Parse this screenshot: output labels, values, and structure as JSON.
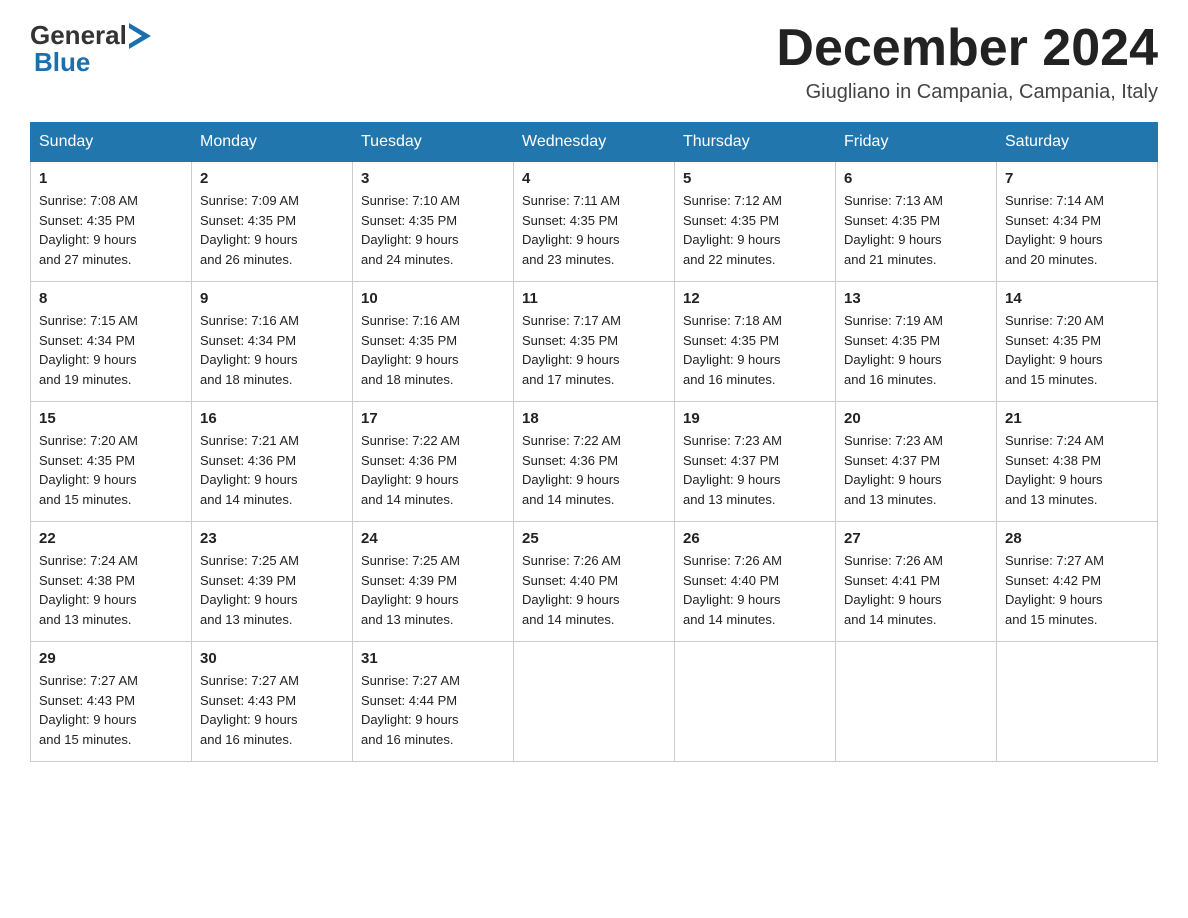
{
  "header": {
    "logo": {
      "general": "General",
      "blue": "Blue"
    },
    "title": "December 2024",
    "location": "Giugliano in Campania, Campania, Italy"
  },
  "days_of_week": [
    "Sunday",
    "Monday",
    "Tuesday",
    "Wednesday",
    "Thursday",
    "Friday",
    "Saturday"
  ],
  "weeks": [
    [
      {
        "day": "1",
        "sunrise": "Sunrise: 7:08 AM",
        "sunset": "Sunset: 4:35 PM",
        "daylight": "Daylight: 9 hours and 27 minutes."
      },
      {
        "day": "2",
        "sunrise": "Sunrise: 7:09 AM",
        "sunset": "Sunset: 4:35 PM",
        "daylight": "Daylight: 9 hours and 26 minutes."
      },
      {
        "day": "3",
        "sunrise": "Sunrise: 7:10 AM",
        "sunset": "Sunset: 4:35 PM",
        "daylight": "Daylight: 9 hours and 24 minutes."
      },
      {
        "day": "4",
        "sunrise": "Sunrise: 7:11 AM",
        "sunset": "Sunset: 4:35 PM",
        "daylight": "Daylight: 9 hours and 23 minutes."
      },
      {
        "day": "5",
        "sunrise": "Sunrise: 7:12 AM",
        "sunset": "Sunset: 4:35 PM",
        "daylight": "Daylight: 9 hours and 22 minutes."
      },
      {
        "day": "6",
        "sunrise": "Sunrise: 7:13 AM",
        "sunset": "Sunset: 4:35 PM",
        "daylight": "Daylight: 9 hours and 21 minutes."
      },
      {
        "day": "7",
        "sunrise": "Sunrise: 7:14 AM",
        "sunset": "Sunset: 4:34 PM",
        "daylight": "Daylight: 9 hours and 20 minutes."
      }
    ],
    [
      {
        "day": "8",
        "sunrise": "Sunrise: 7:15 AM",
        "sunset": "Sunset: 4:34 PM",
        "daylight": "Daylight: 9 hours and 19 minutes."
      },
      {
        "day": "9",
        "sunrise": "Sunrise: 7:16 AM",
        "sunset": "Sunset: 4:34 PM",
        "daylight": "Daylight: 9 hours and 18 minutes."
      },
      {
        "day": "10",
        "sunrise": "Sunrise: 7:16 AM",
        "sunset": "Sunset: 4:35 PM",
        "daylight": "Daylight: 9 hours and 18 minutes."
      },
      {
        "day": "11",
        "sunrise": "Sunrise: 7:17 AM",
        "sunset": "Sunset: 4:35 PM",
        "daylight": "Daylight: 9 hours and 17 minutes."
      },
      {
        "day": "12",
        "sunrise": "Sunrise: 7:18 AM",
        "sunset": "Sunset: 4:35 PM",
        "daylight": "Daylight: 9 hours and 16 minutes."
      },
      {
        "day": "13",
        "sunrise": "Sunrise: 7:19 AM",
        "sunset": "Sunset: 4:35 PM",
        "daylight": "Daylight: 9 hours and 16 minutes."
      },
      {
        "day": "14",
        "sunrise": "Sunrise: 7:20 AM",
        "sunset": "Sunset: 4:35 PM",
        "daylight": "Daylight: 9 hours and 15 minutes."
      }
    ],
    [
      {
        "day": "15",
        "sunrise": "Sunrise: 7:20 AM",
        "sunset": "Sunset: 4:35 PM",
        "daylight": "Daylight: 9 hours and 15 minutes."
      },
      {
        "day": "16",
        "sunrise": "Sunrise: 7:21 AM",
        "sunset": "Sunset: 4:36 PM",
        "daylight": "Daylight: 9 hours and 14 minutes."
      },
      {
        "day": "17",
        "sunrise": "Sunrise: 7:22 AM",
        "sunset": "Sunset: 4:36 PM",
        "daylight": "Daylight: 9 hours and 14 minutes."
      },
      {
        "day": "18",
        "sunrise": "Sunrise: 7:22 AM",
        "sunset": "Sunset: 4:36 PM",
        "daylight": "Daylight: 9 hours and 14 minutes."
      },
      {
        "day": "19",
        "sunrise": "Sunrise: 7:23 AM",
        "sunset": "Sunset: 4:37 PM",
        "daylight": "Daylight: 9 hours and 13 minutes."
      },
      {
        "day": "20",
        "sunrise": "Sunrise: 7:23 AM",
        "sunset": "Sunset: 4:37 PM",
        "daylight": "Daylight: 9 hours and 13 minutes."
      },
      {
        "day": "21",
        "sunrise": "Sunrise: 7:24 AM",
        "sunset": "Sunset: 4:38 PM",
        "daylight": "Daylight: 9 hours and 13 minutes."
      }
    ],
    [
      {
        "day": "22",
        "sunrise": "Sunrise: 7:24 AM",
        "sunset": "Sunset: 4:38 PM",
        "daylight": "Daylight: 9 hours and 13 minutes."
      },
      {
        "day": "23",
        "sunrise": "Sunrise: 7:25 AM",
        "sunset": "Sunset: 4:39 PM",
        "daylight": "Daylight: 9 hours and 13 minutes."
      },
      {
        "day": "24",
        "sunrise": "Sunrise: 7:25 AM",
        "sunset": "Sunset: 4:39 PM",
        "daylight": "Daylight: 9 hours and 13 minutes."
      },
      {
        "day": "25",
        "sunrise": "Sunrise: 7:26 AM",
        "sunset": "Sunset: 4:40 PM",
        "daylight": "Daylight: 9 hours and 14 minutes."
      },
      {
        "day": "26",
        "sunrise": "Sunrise: 7:26 AM",
        "sunset": "Sunset: 4:40 PM",
        "daylight": "Daylight: 9 hours and 14 minutes."
      },
      {
        "day": "27",
        "sunrise": "Sunrise: 7:26 AM",
        "sunset": "Sunset: 4:41 PM",
        "daylight": "Daylight: 9 hours and 14 minutes."
      },
      {
        "day": "28",
        "sunrise": "Sunrise: 7:27 AM",
        "sunset": "Sunset: 4:42 PM",
        "daylight": "Daylight: 9 hours and 15 minutes."
      }
    ],
    [
      {
        "day": "29",
        "sunrise": "Sunrise: 7:27 AM",
        "sunset": "Sunset: 4:43 PM",
        "daylight": "Daylight: 9 hours and 15 minutes."
      },
      {
        "day": "30",
        "sunrise": "Sunrise: 7:27 AM",
        "sunset": "Sunset: 4:43 PM",
        "daylight": "Daylight: 9 hours and 16 minutes."
      },
      {
        "day": "31",
        "sunrise": "Sunrise: 7:27 AM",
        "sunset": "Sunset: 4:44 PM",
        "daylight": "Daylight: 9 hours and 16 minutes."
      },
      null,
      null,
      null,
      null
    ]
  ]
}
